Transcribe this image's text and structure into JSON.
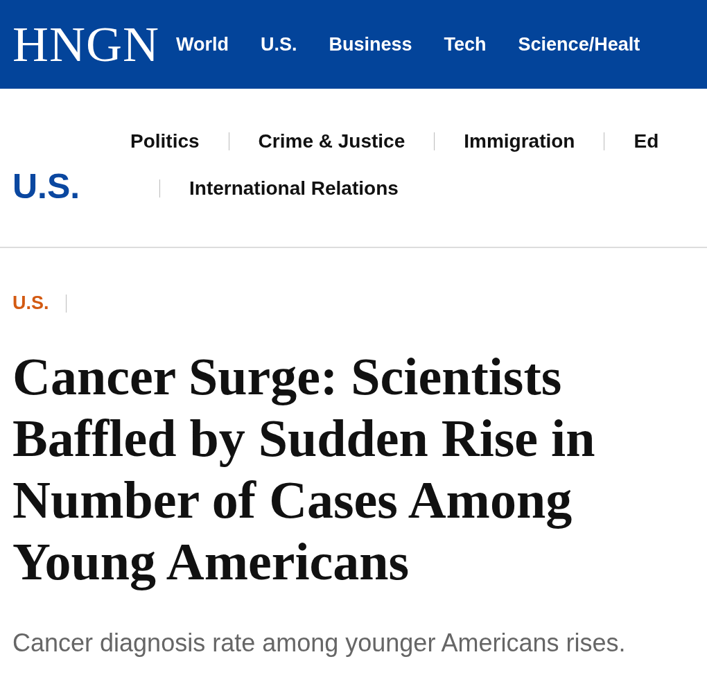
{
  "site": {
    "logo": "HNGN",
    "nav": [
      "World",
      "U.S.",
      "Business",
      "Tech",
      "Science/Healt"
    ]
  },
  "section": {
    "title": "U.S.",
    "subnav_rows": [
      [
        "Politics",
        "Crime & Justice",
        "Immigration",
        "Ed"
      ],
      [
        "International Relations"
      ]
    ]
  },
  "article": {
    "category": "U.S.",
    "headline": "Cancer Surge: Scientists Baffled by Sudden Rise in Number of Cases Among Young Americans",
    "subtitle": "Cancer diagnosis rate among younger Americans rises."
  }
}
